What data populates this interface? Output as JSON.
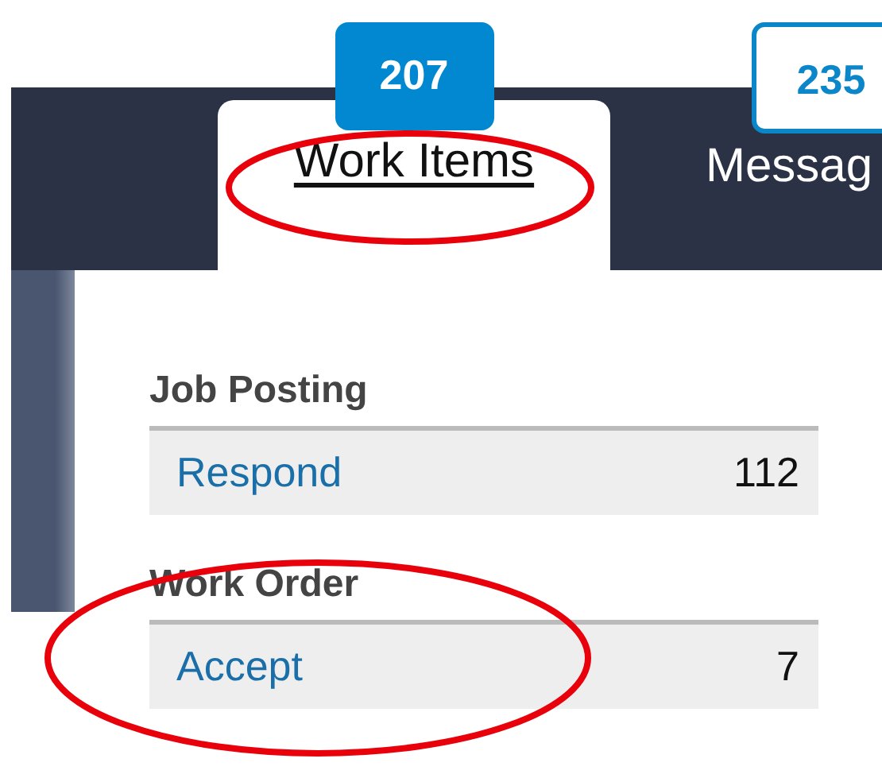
{
  "tabs": [
    {
      "label": "Work Items",
      "badge": "207",
      "selected": true
    },
    {
      "label": "Messag",
      "badge": "235",
      "selected": false
    }
  ],
  "sections": [
    {
      "title": "Job Posting",
      "rows": [
        {
          "action": "Respond",
          "count": "112"
        }
      ]
    },
    {
      "title": "Work Order",
      "rows": [
        {
          "action": "Accept",
          "count": "7"
        }
      ]
    }
  ]
}
